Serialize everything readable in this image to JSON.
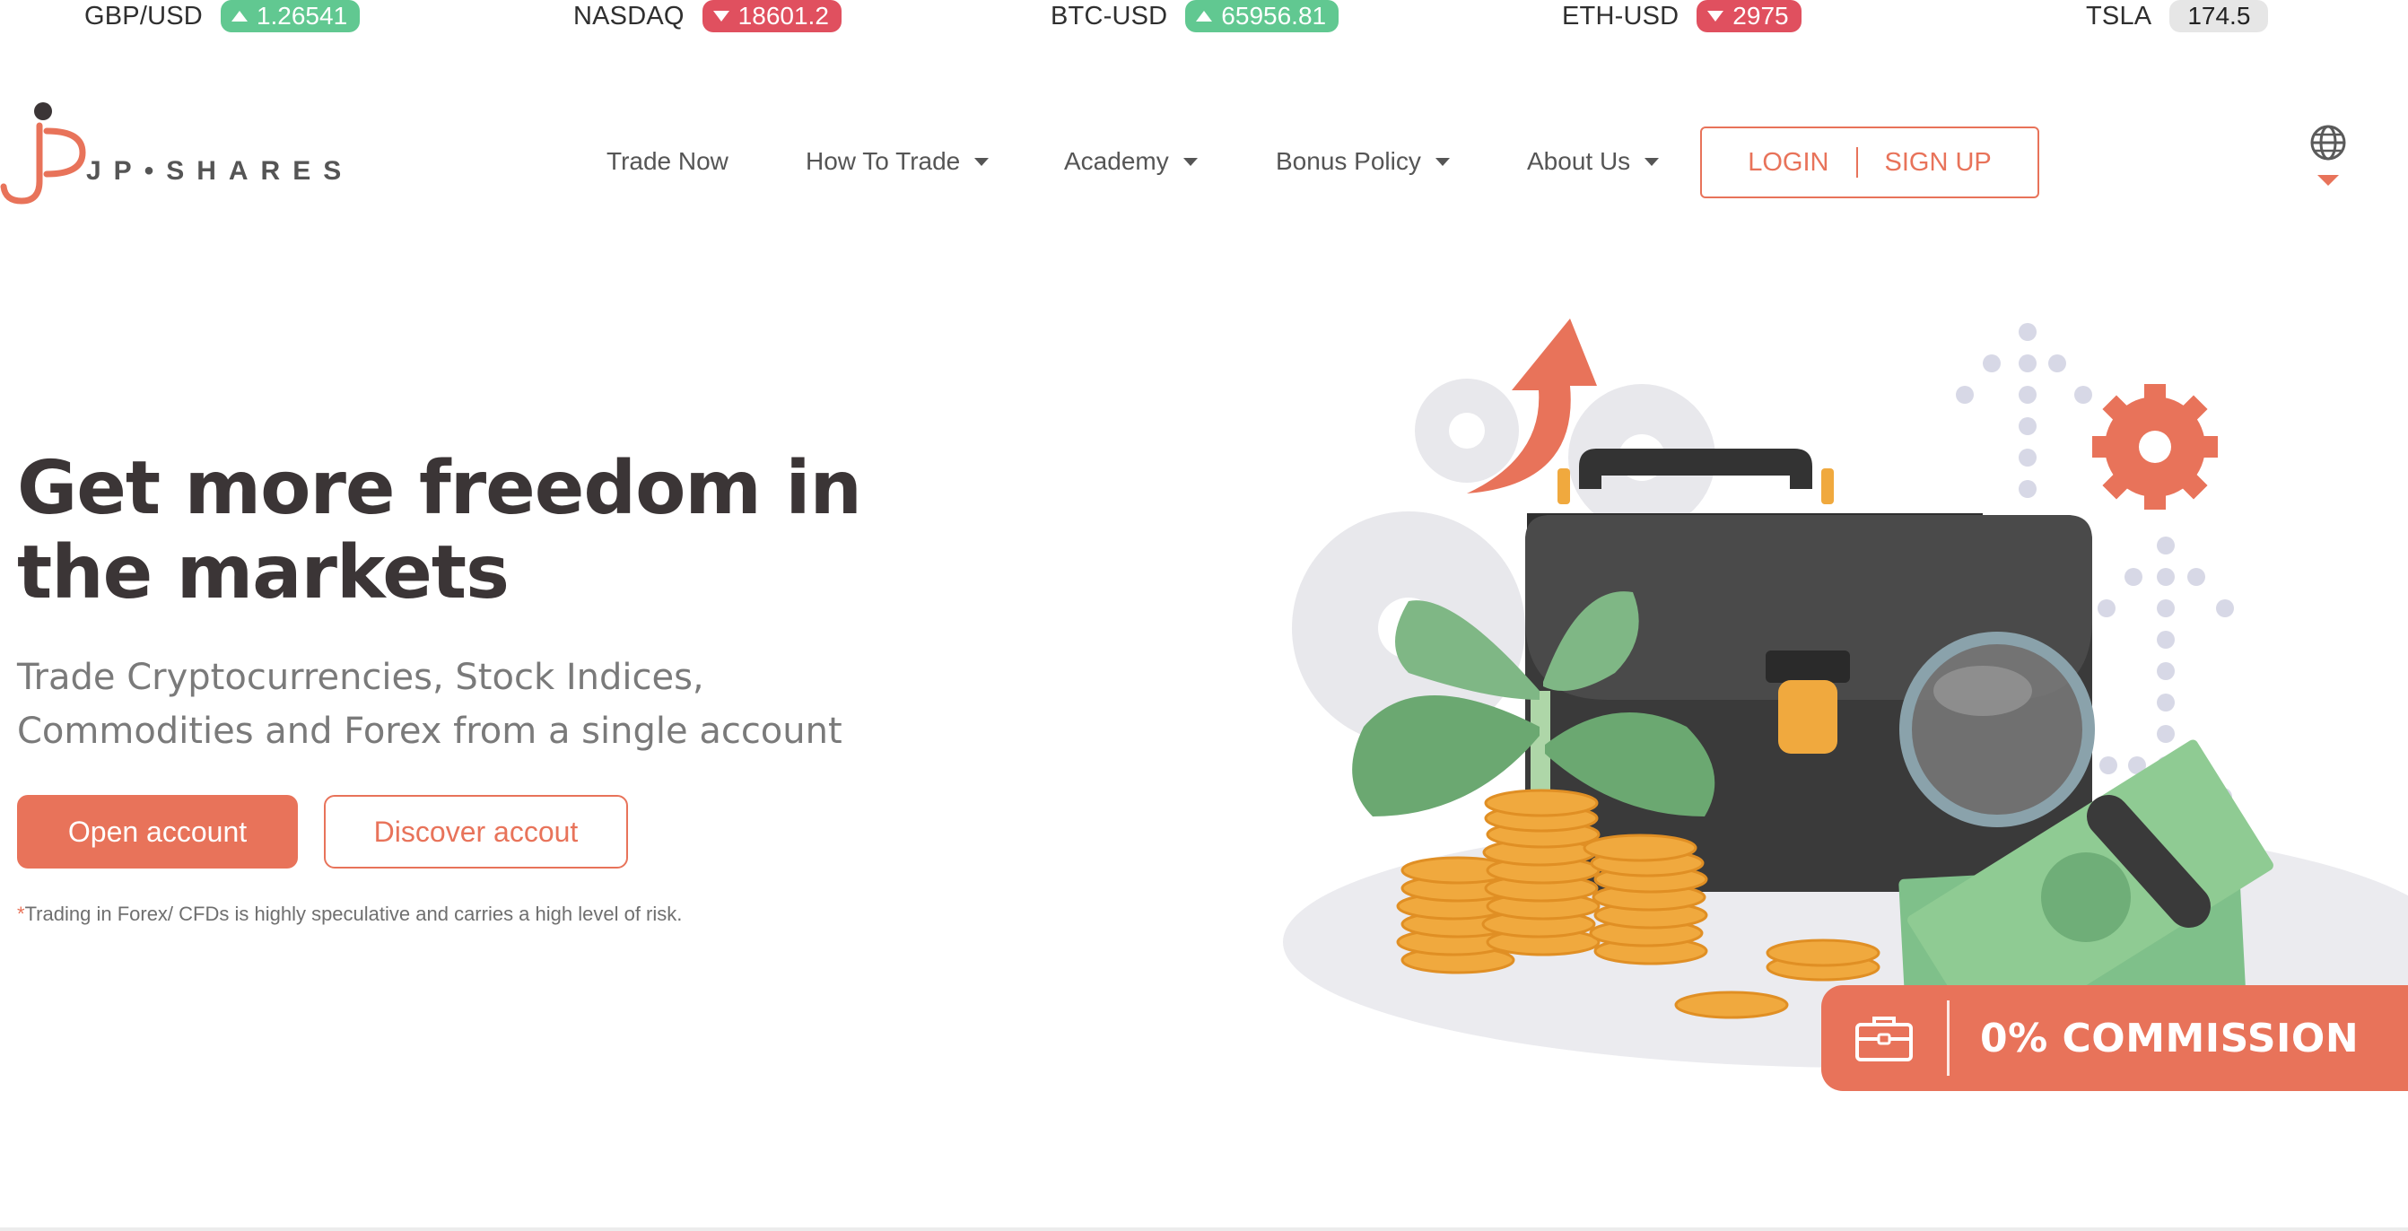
{
  "ticker": [
    {
      "symbol": "GBP/USD",
      "value": "1.26541",
      "direction": "up"
    },
    {
      "symbol": "NASDAQ",
      "value": "18601.2",
      "direction": "down"
    },
    {
      "symbol": "BTC-USD",
      "value": "65956.81",
      "direction": "up"
    },
    {
      "symbol": "ETH-USD",
      "value": "2975",
      "direction": "down"
    },
    {
      "symbol": "TSLA",
      "value": "174.5",
      "direction": "flat"
    }
  ],
  "brand": {
    "logo_text": "JP•SHARES",
    "accent": "#e8735a"
  },
  "nav": {
    "items": [
      {
        "label": "Trade Now",
        "has_dropdown": false
      },
      {
        "label": "How To Trade",
        "has_dropdown": true
      },
      {
        "label": "Academy",
        "has_dropdown": true
      },
      {
        "label": "Bonus Policy",
        "has_dropdown": true
      },
      {
        "label": "About Us",
        "has_dropdown": true
      }
    ],
    "login_label": "LOGIN",
    "signup_label": "SIGN UP",
    "language_icon": "globe-icon"
  },
  "hero": {
    "title_part1": "Get more ",
    "title_highlight": "freedom",
    "title_part2": " in the markets",
    "subtitle": "Trade Cryptocurrencies, Stock Indices, Commodities and Forex from a single account",
    "primary_cta": "Open account",
    "secondary_cta": "Discover accout",
    "disclaimer_mark": "*",
    "disclaimer": "Trading in Forex/ CFDs is highly speculative and carries a high level of risk."
  },
  "commission_badge": {
    "text": "0% COMMISSION",
    "icon": "briefcase-icon"
  },
  "colors": {
    "up": "#61c891",
    "down": "#e0505f",
    "flat": "#e6e6e6",
    "text_dark": "#3b3536",
    "text_muted": "#7a7a7a"
  }
}
